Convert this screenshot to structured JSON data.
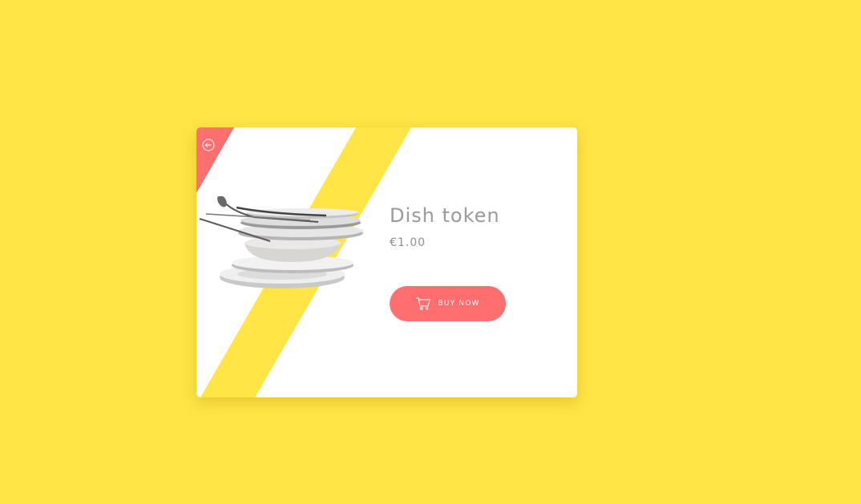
{
  "product": {
    "title": "Dish token",
    "price": "€1.00",
    "buy_label": "BUY NOW"
  },
  "icons": {
    "back": "arrow-left-circle-icon",
    "cart": "shopping-cart-icon",
    "product_image": "stacked-dishes-image"
  },
  "colors": {
    "background": "#FFE545",
    "card": "#FFFFFF",
    "accent": "#FF6F6F",
    "stripe": "#FFE545",
    "title_text": "#9A9A9A"
  }
}
